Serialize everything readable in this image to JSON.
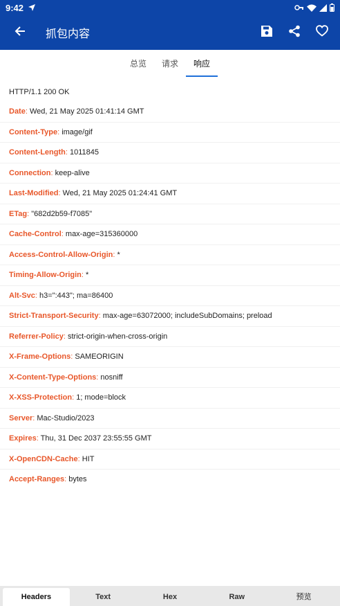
{
  "status_bar": {
    "time": "9:42"
  },
  "app_bar": {
    "title": "抓包内容"
  },
  "tabs": [
    {
      "label": "总览",
      "active": false
    },
    {
      "label": "请求",
      "active": false
    },
    {
      "label": "响应",
      "active": true
    }
  ],
  "response": {
    "status_line": "HTTP/1.1 200 OK",
    "headers": [
      {
        "name": "Date",
        "value": "Wed, 21 May 2025 01:41:14 GMT"
      },
      {
        "name": "Content-Type",
        "value": "image/gif"
      },
      {
        "name": "Content-Length",
        "value": "1011845"
      },
      {
        "name": "Connection",
        "value": "keep-alive"
      },
      {
        "name": "Last-Modified",
        "value": "Wed, 21 May 2025 01:24:41 GMT"
      },
      {
        "name": "ETag",
        "value": "\"682d2b59-f7085\""
      },
      {
        "name": "Cache-Control",
        "value": "max-age=315360000"
      },
      {
        "name": "Access-Control-Allow-Origin",
        "value": "*"
      },
      {
        "name": "Timing-Allow-Origin",
        "value": "*"
      },
      {
        "name": "Alt-Svc",
        "value": "h3=\":443\"; ma=86400"
      },
      {
        "name": "Strict-Transport-Security",
        "value": "max-age=63072000; includeSubDomains; preload"
      },
      {
        "name": "Referrer-Policy",
        "value": "strict-origin-when-cross-origin"
      },
      {
        "name": "X-Frame-Options",
        "value": "SAMEORIGIN"
      },
      {
        "name": "X-Content-Type-Options",
        "value": "nosniff"
      },
      {
        "name": "X-XSS-Protection",
        "value": "1; mode=block"
      },
      {
        "name": "Server",
        "value": "Mac-Studio/2023"
      },
      {
        "name": "Expires",
        "value": "Thu, 31 Dec 2037 23:55:55 GMT"
      },
      {
        "name": "X-OpenCDN-Cache",
        "value": "HIT"
      },
      {
        "name": "Accept-Ranges",
        "value": "bytes"
      }
    ]
  },
  "bottom_tabs": [
    {
      "label": "Headers",
      "active": true
    },
    {
      "label": "Text",
      "active": false
    },
    {
      "label": "Hex",
      "active": false
    },
    {
      "label": "Raw",
      "active": false
    },
    {
      "label": "预览",
      "active": false
    }
  ],
  "colors": {
    "app_bar": "#0d45a8",
    "header_name": "#e8572a",
    "tab_indicator": "#1e6fd9"
  },
  "icons": {
    "back": "arrow-left-icon",
    "save": "save-icon",
    "share": "share-icon",
    "favorite": "heart-icon"
  }
}
